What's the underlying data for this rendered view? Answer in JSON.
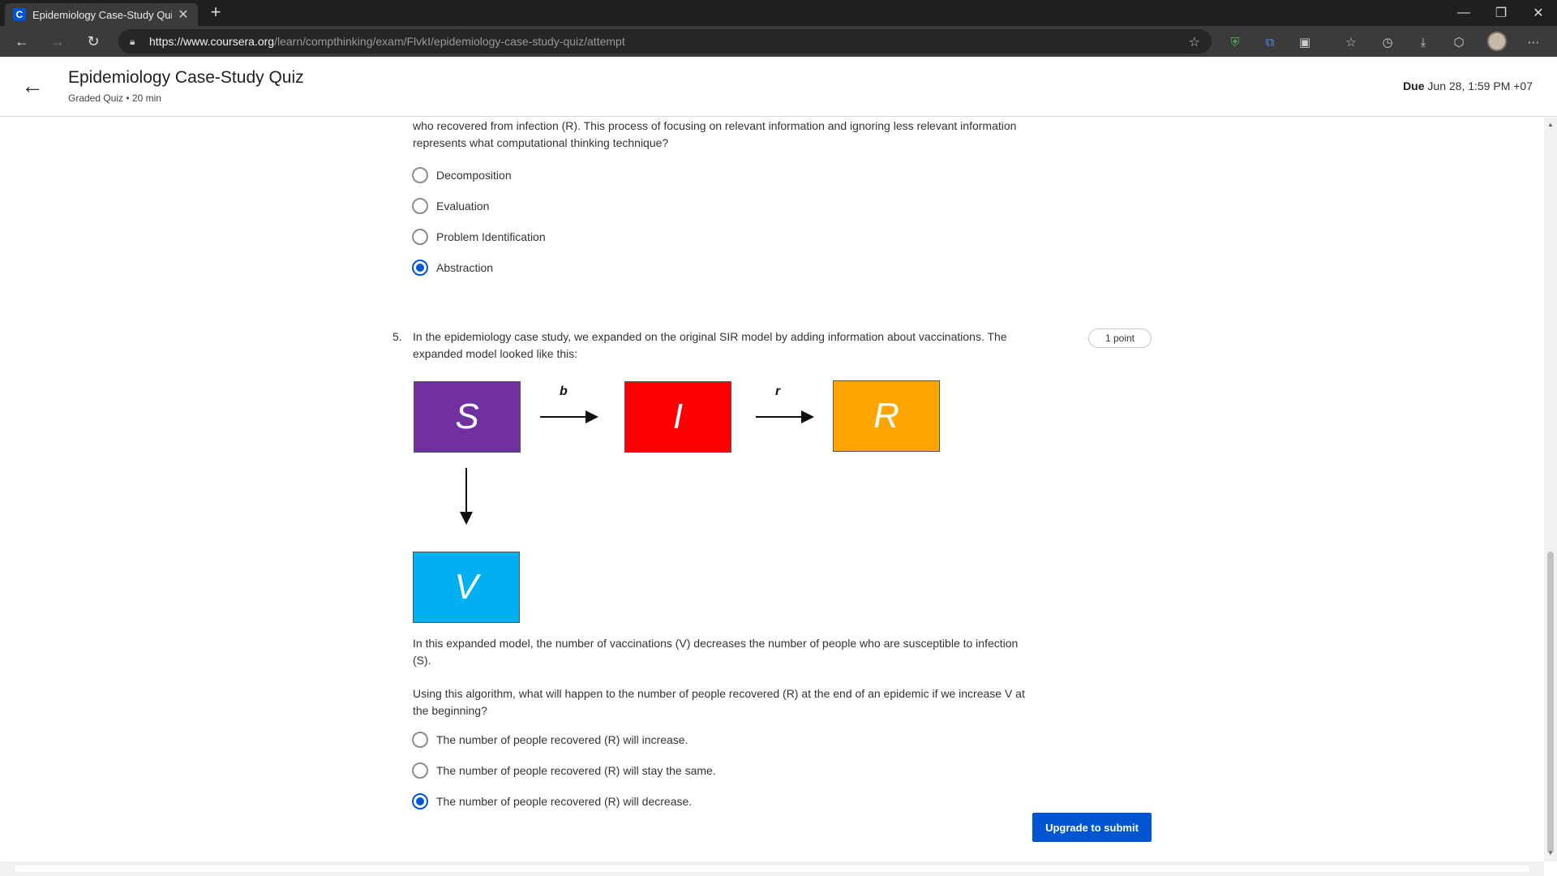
{
  "browser": {
    "tab_title": "Epidemiology Case-Study Quiz |",
    "favicon_letter": "C",
    "url_scheme": "https://",
    "url_host": "www.coursera.org",
    "url_path": "/learn/compthinking/exam/FlvkI/epidemiology-case-study-quiz/attempt"
  },
  "header": {
    "title": "Epidemiology Case-Study Quiz",
    "subtitle": "Graded Quiz • 20 min",
    "due_label": "Due",
    "due_value": "Jun 28, 1:59 PM +07"
  },
  "q4": {
    "text_line1": "who recovered from infection (R). This process of focusing on relevant information and ignoring less relevant information",
    "text_line2": "represents what computational thinking technique?",
    "options": [
      {
        "label": "Decomposition",
        "selected": false
      },
      {
        "label": "Evaluation",
        "selected": false
      },
      {
        "label": "Problem Identification",
        "selected": false
      },
      {
        "label": "Abstraction",
        "selected": true
      }
    ]
  },
  "q5": {
    "number": "5.",
    "text_line1": "In the epidemiology case study, we expanded on the original SIR model by adding information about vaccinations. The",
    "text_line2": "expanded model looked like this:",
    "points": "1 point",
    "diagram": {
      "boxes": [
        {
          "label": "S",
          "color": "#7030a0"
        },
        {
          "label": "I",
          "color": "#ff0000"
        },
        {
          "label": "R",
          "color": "#ffa500"
        },
        {
          "label": "V",
          "color": "#00b0f0"
        }
      ],
      "edge_labels": [
        "b",
        "r"
      ]
    },
    "para1_line1": "In this expanded model, the number of vaccinations (V) decreases the number of people who are susceptible to infection",
    "para1_line2": "(S).",
    "para2_line1": "Using this algorithm, what will happen to the number of people recovered (R) at the end of an epidemic if we increase V at",
    "para2_line2": "the beginning?",
    "options": [
      {
        "label": "The number of people recovered (R) will increase.",
        "selected": false
      },
      {
        "label": "The number of people recovered (R) will stay the same.",
        "selected": false
      },
      {
        "label": "The number of people recovered (R) will decrease.",
        "selected": true
      }
    ]
  },
  "submit_label": "Upgrade to submit"
}
